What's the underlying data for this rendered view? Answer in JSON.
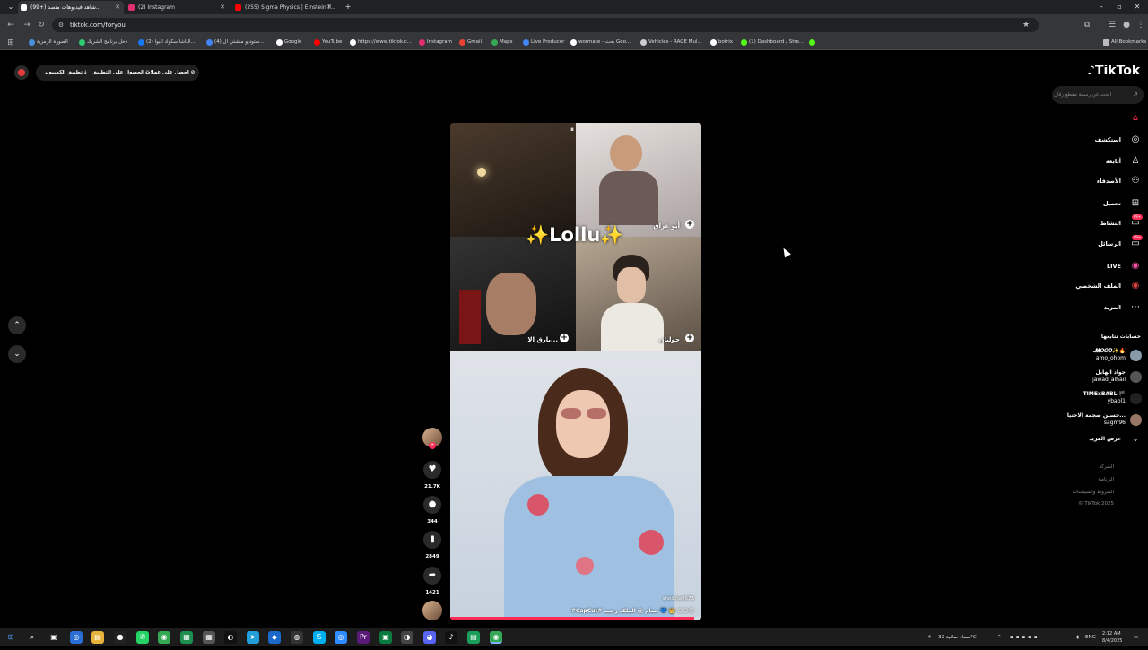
{
  "browser": {
    "tabs": [
      {
        "label": "(99+) شاهد فيديوهات متصد...",
        "active": true,
        "favicon_color": "#ffffff"
      },
      {
        "label": "(2) Instagram",
        "active": false,
        "favicon_color": "#e1306c"
      },
      {
        "label": "(255) Sigma Physics | Einstein F...",
        "active": false,
        "favicon_color": "#ff0000"
      }
    ],
    "new_tab": "+",
    "url": "tiktok.com/foryou",
    "bookmarks": [
      {
        "label": "الصورة الرمزية",
        "color": "#4a90d9"
      },
      {
        "label": "دخل برنامج الشريك",
        "color": "#2ecc71"
      },
      {
        "label": "(2) الباشا سكواد البوا...",
        "color": "#1877f2"
      },
      {
        "label": "(4) ستوديو منشئي ال...",
        "color": "#4285f4"
      },
      {
        "label": "Google",
        "color": "#ffffff"
      },
      {
        "label": "YouTube",
        "color": "#ff0000"
      },
      {
        "label": "https://www.tiktok.c...",
        "color": "#ffffff"
      },
      {
        "label": "Instagram",
        "color": "#e1306c"
      },
      {
        "label": "Gmail",
        "color": "#ea4335"
      },
      {
        "label": "Maps",
        "color": "#34a853"
      },
      {
        "label": "Live Producer",
        "color": "#4285f4"
      },
      {
        "label": "wormate - بحث Goo...",
        "color": "#ffffff"
      },
      {
        "label": "Vehicles - RAGE Mul...",
        "color": "#cccccc"
      },
      {
        "label": "botrix",
        "color": "#ffffff"
      },
      {
        "label": "(1) Dashboard / Stre...",
        "color": "#53fc18"
      }
    ],
    "all_bookmarks": "All Bookmarks"
  },
  "topbar": {
    "get_coins": "احصل على عملات",
    "get_app": "الحصول على التطبيق",
    "pc_app": "تطبيق الكمبيوتر"
  },
  "sidebar": {
    "logo": "TikTok",
    "search_placeholder": "ابحث عن رسمة مقطع رقال",
    "items": [
      {
        "label": "",
        "icon": "home-icon"
      },
      {
        "label": "استكشف",
        "icon": "compass-icon"
      },
      {
        "label": "أتابعه",
        "icon": "user-follow-icon"
      },
      {
        "label": "الأصدقاء",
        "icon": "friends-icon"
      },
      {
        "label": "تحميل",
        "icon": "upload-icon"
      },
      {
        "label": "النشاط",
        "icon": "activity-icon",
        "badge": "99+"
      },
      {
        "label": "الرسائل",
        "icon": "messages-icon",
        "badge": "99+"
      },
      {
        "label": "LIVE",
        "icon": "live-icon"
      },
      {
        "label": "الملف الشخصي",
        "icon": "profile-icon"
      },
      {
        "label": "المزيد",
        "icon": "more-icon"
      }
    ],
    "following_title": "حسابات تتابعها",
    "following": [
      {
        "name": "ـ𝑴𝑶𝑶𝑫✨🔥",
        "handle": "amo_ohom",
        "avatar_color": "#8899aa"
      },
      {
        "name": "جواد الهايل",
        "handle": "jawad_alhail",
        "avatar_color": "#555555"
      },
      {
        "name": "TIMExBABL 🏴",
        "handle": "ybabl1",
        "avatar_color": "#222222"
      },
      {
        "name": "حسين صجمة الاحتيا...",
        "handle": "sagm96",
        "avatar_color": "#997766"
      }
    ],
    "see_more": "عرض المزيد",
    "footer": [
      "الشركة",
      "البرنامج",
      "الشروط والسياسات",
      "© TikTok 2025"
    ]
  },
  "video": {
    "overlay_title": "✨Lollu✨",
    "cells": [
      {
        "label": "",
        "color": "#3a2d22"
      },
      {
        "label": "أبو عراق",
        "color": "#cfc7c5"
      },
      {
        "label": "بارق الا...",
        "color": "#252525"
      },
      {
        "label": "جوليان",
        "color": "#8a7b6a"
      }
    ],
    "creator_tag": "sheikha9673",
    "caption": "#CapCut# بسام @ الملكة رحمة 💙 👑 😊😊😊",
    "progress": 0.97
  },
  "actions": {
    "likes": "21.7K",
    "comments": "344",
    "saves": "2849",
    "shares": "1421"
  },
  "taskbar": {
    "weather": "سماء صافية 32°C",
    "lang": "ENG",
    "time": "2:12 AM",
    "date": "8/4/2025"
  }
}
